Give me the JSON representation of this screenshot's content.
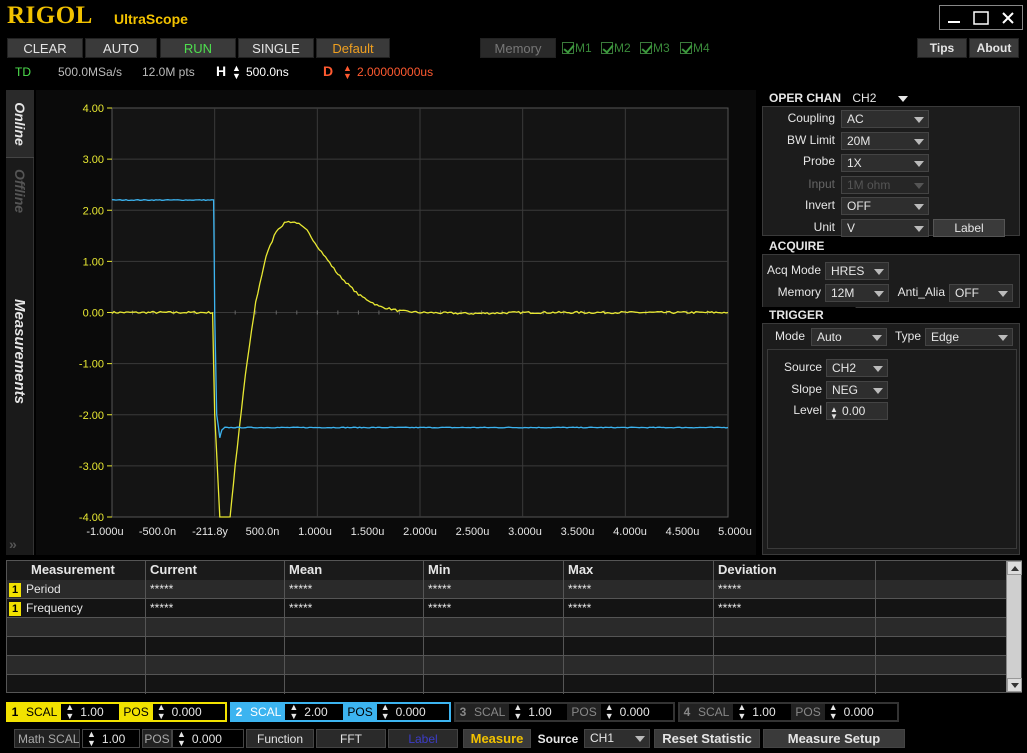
{
  "app": {
    "logo": "RIGOL",
    "name": "UltraScope"
  },
  "toolbar": {
    "clear": "CLEAR",
    "auto": "AUTO",
    "run": "RUN",
    "single": "SINGLE",
    "default": "Default",
    "memory": "Memory",
    "mem_channels": [
      "M1",
      "M2",
      "M3",
      "M4"
    ],
    "tips": "Tips",
    "about": "About"
  },
  "status": {
    "mode": "TD",
    "sample_rate": "500.0MSa/s",
    "points": "12.0M pts",
    "h_label": "H",
    "h_value": "500.0ns",
    "d_label": "D",
    "d_value": "2.00000000us"
  },
  "tabs": {
    "online": "Online",
    "offline": "Offline",
    "measurements": "Measurements"
  },
  "chart_data": {
    "type": "line",
    "y_ticks": [
      "4.00",
      "3.00",
      "2.00",
      "1.00",
      "0.00",
      "-1.00",
      "-2.00",
      "-3.00",
      "-4.00"
    ],
    "x_ticks": [
      "-1.000u",
      "-500.0n",
      "-211.8y",
      "500.0n",
      "1.000u",
      "1.500u",
      "2.000u",
      "2.500u",
      "3.000u",
      "3.500u",
      "4.000u",
      "4.500u",
      "5.000u"
    ],
    "xlim": [
      -1.0,
      5.0
    ],
    "ylim": [
      -4.0,
      4.0
    ],
    "grid": true,
    "series": [
      {
        "channel": "CH1",
        "color": "#e8e832",
        "x": [
          -1.0,
          -0.02,
          0.0,
          0.05,
          0.1,
          0.15,
          0.2,
          0.3,
          0.4,
          0.5,
          0.6,
          0.7,
          0.8,
          0.9,
          1.0,
          1.2,
          1.4,
          1.6,
          1.8,
          2.0,
          2.5,
          3.0,
          4.0,
          5.0
        ],
        "y": [
          0.0,
          0.0,
          -2.0,
          -4.0,
          -4.0,
          -4.0,
          -3.0,
          -1.2,
          0.2,
          1.1,
          1.6,
          1.78,
          1.76,
          1.6,
          1.3,
          0.75,
          0.35,
          0.12,
          0.03,
          0.0,
          -0.02,
          0.0,
          0.0,
          0.0
        ]
      },
      {
        "channel": "CH2",
        "color": "#3cb4f0",
        "x": [
          -1.0,
          -0.01,
          0.0,
          0.02,
          0.05,
          0.07,
          0.1,
          0.3,
          1.0,
          2.0,
          3.0,
          4.0,
          5.0
        ],
        "y": [
          2.2,
          2.2,
          0.0,
          -2.0,
          -2.45,
          -2.3,
          -2.25,
          -2.25,
          -2.25,
          -2.25,
          -2.25,
          -2.25,
          -2.25
        ]
      }
    ]
  },
  "oper_chan": {
    "title": "OPER CHAN",
    "value": "CH2",
    "rows": [
      {
        "label": "Coupling",
        "value": "AC",
        "enabled": true
      },
      {
        "label": "BW Limit",
        "value": "20M",
        "enabled": true
      },
      {
        "label": "Probe",
        "value": "1X",
        "enabled": true
      },
      {
        "label": "Input",
        "value": "1M ohm",
        "enabled": false
      },
      {
        "label": "Invert",
        "value": "OFF",
        "enabled": true
      },
      {
        "label": "Unit",
        "value": "V",
        "enabled": true
      }
    ],
    "label_button": "Label"
  },
  "acquire": {
    "title": "ACQUIRE",
    "acq_mode_label": "Acq Mode",
    "acq_mode": "HRES",
    "memory_label": "Memory",
    "memory": "12M",
    "anti_alias_label": "Anti_Alia",
    "anti_alias": "OFF"
  },
  "trigger": {
    "title": "TRIGGER",
    "mode_label": "Mode",
    "mode": "Auto",
    "type_label": "Type",
    "type": "Edge",
    "source_label": "Source",
    "source": "CH2",
    "slope_label": "Slope",
    "slope": "NEG",
    "level_label": "Level",
    "level": "0.00"
  },
  "measurements": {
    "headers": [
      "Measurement",
      "Current",
      "Mean",
      "Min",
      "Max",
      "Deviation"
    ],
    "rows": [
      {
        "channel": "1",
        "name": "Period",
        "current": "*****",
        "mean": "*****",
        "min": "*****",
        "max": "*****",
        "deviation": "*****"
      },
      {
        "channel": "1",
        "name": "Frequency",
        "current": "*****",
        "mean": "*****",
        "min": "*****",
        "max": "*****",
        "deviation": "*****"
      }
    ]
  },
  "channels": [
    {
      "num": "1",
      "scal_label": "SCAL",
      "scal": "1.00",
      "pos_label": "POS",
      "pos": "0.000",
      "color": "#f2e200",
      "active": true
    },
    {
      "num": "2",
      "scal_label": "SCAL",
      "scal": "2.00",
      "pos_label": "POS",
      "pos": "0.000",
      "color": "#3cb4f0",
      "active": true
    },
    {
      "num": "3",
      "scal_label": "SCAL",
      "scal": "1.00",
      "pos_label": "POS",
      "pos": "0.000",
      "color": "#666666",
      "active": false
    },
    {
      "num": "4",
      "scal_label": "SCAL",
      "scal": "1.00",
      "pos_label": "POS",
      "pos": "0.000",
      "color": "#666666",
      "active": false
    }
  ],
  "bottom": {
    "math_label": "Math",
    "math_scal_label": "SCAL",
    "math_scal": "1.00",
    "math_pos_label": "POS",
    "math_pos": "0.000",
    "function": "Function",
    "fft": "FFT",
    "label": "Label",
    "measure": "Measure",
    "source_label": "Source",
    "source": "CH1",
    "reset_statistic": "Reset  Statistic",
    "measure_setup": "Measure Setup"
  }
}
